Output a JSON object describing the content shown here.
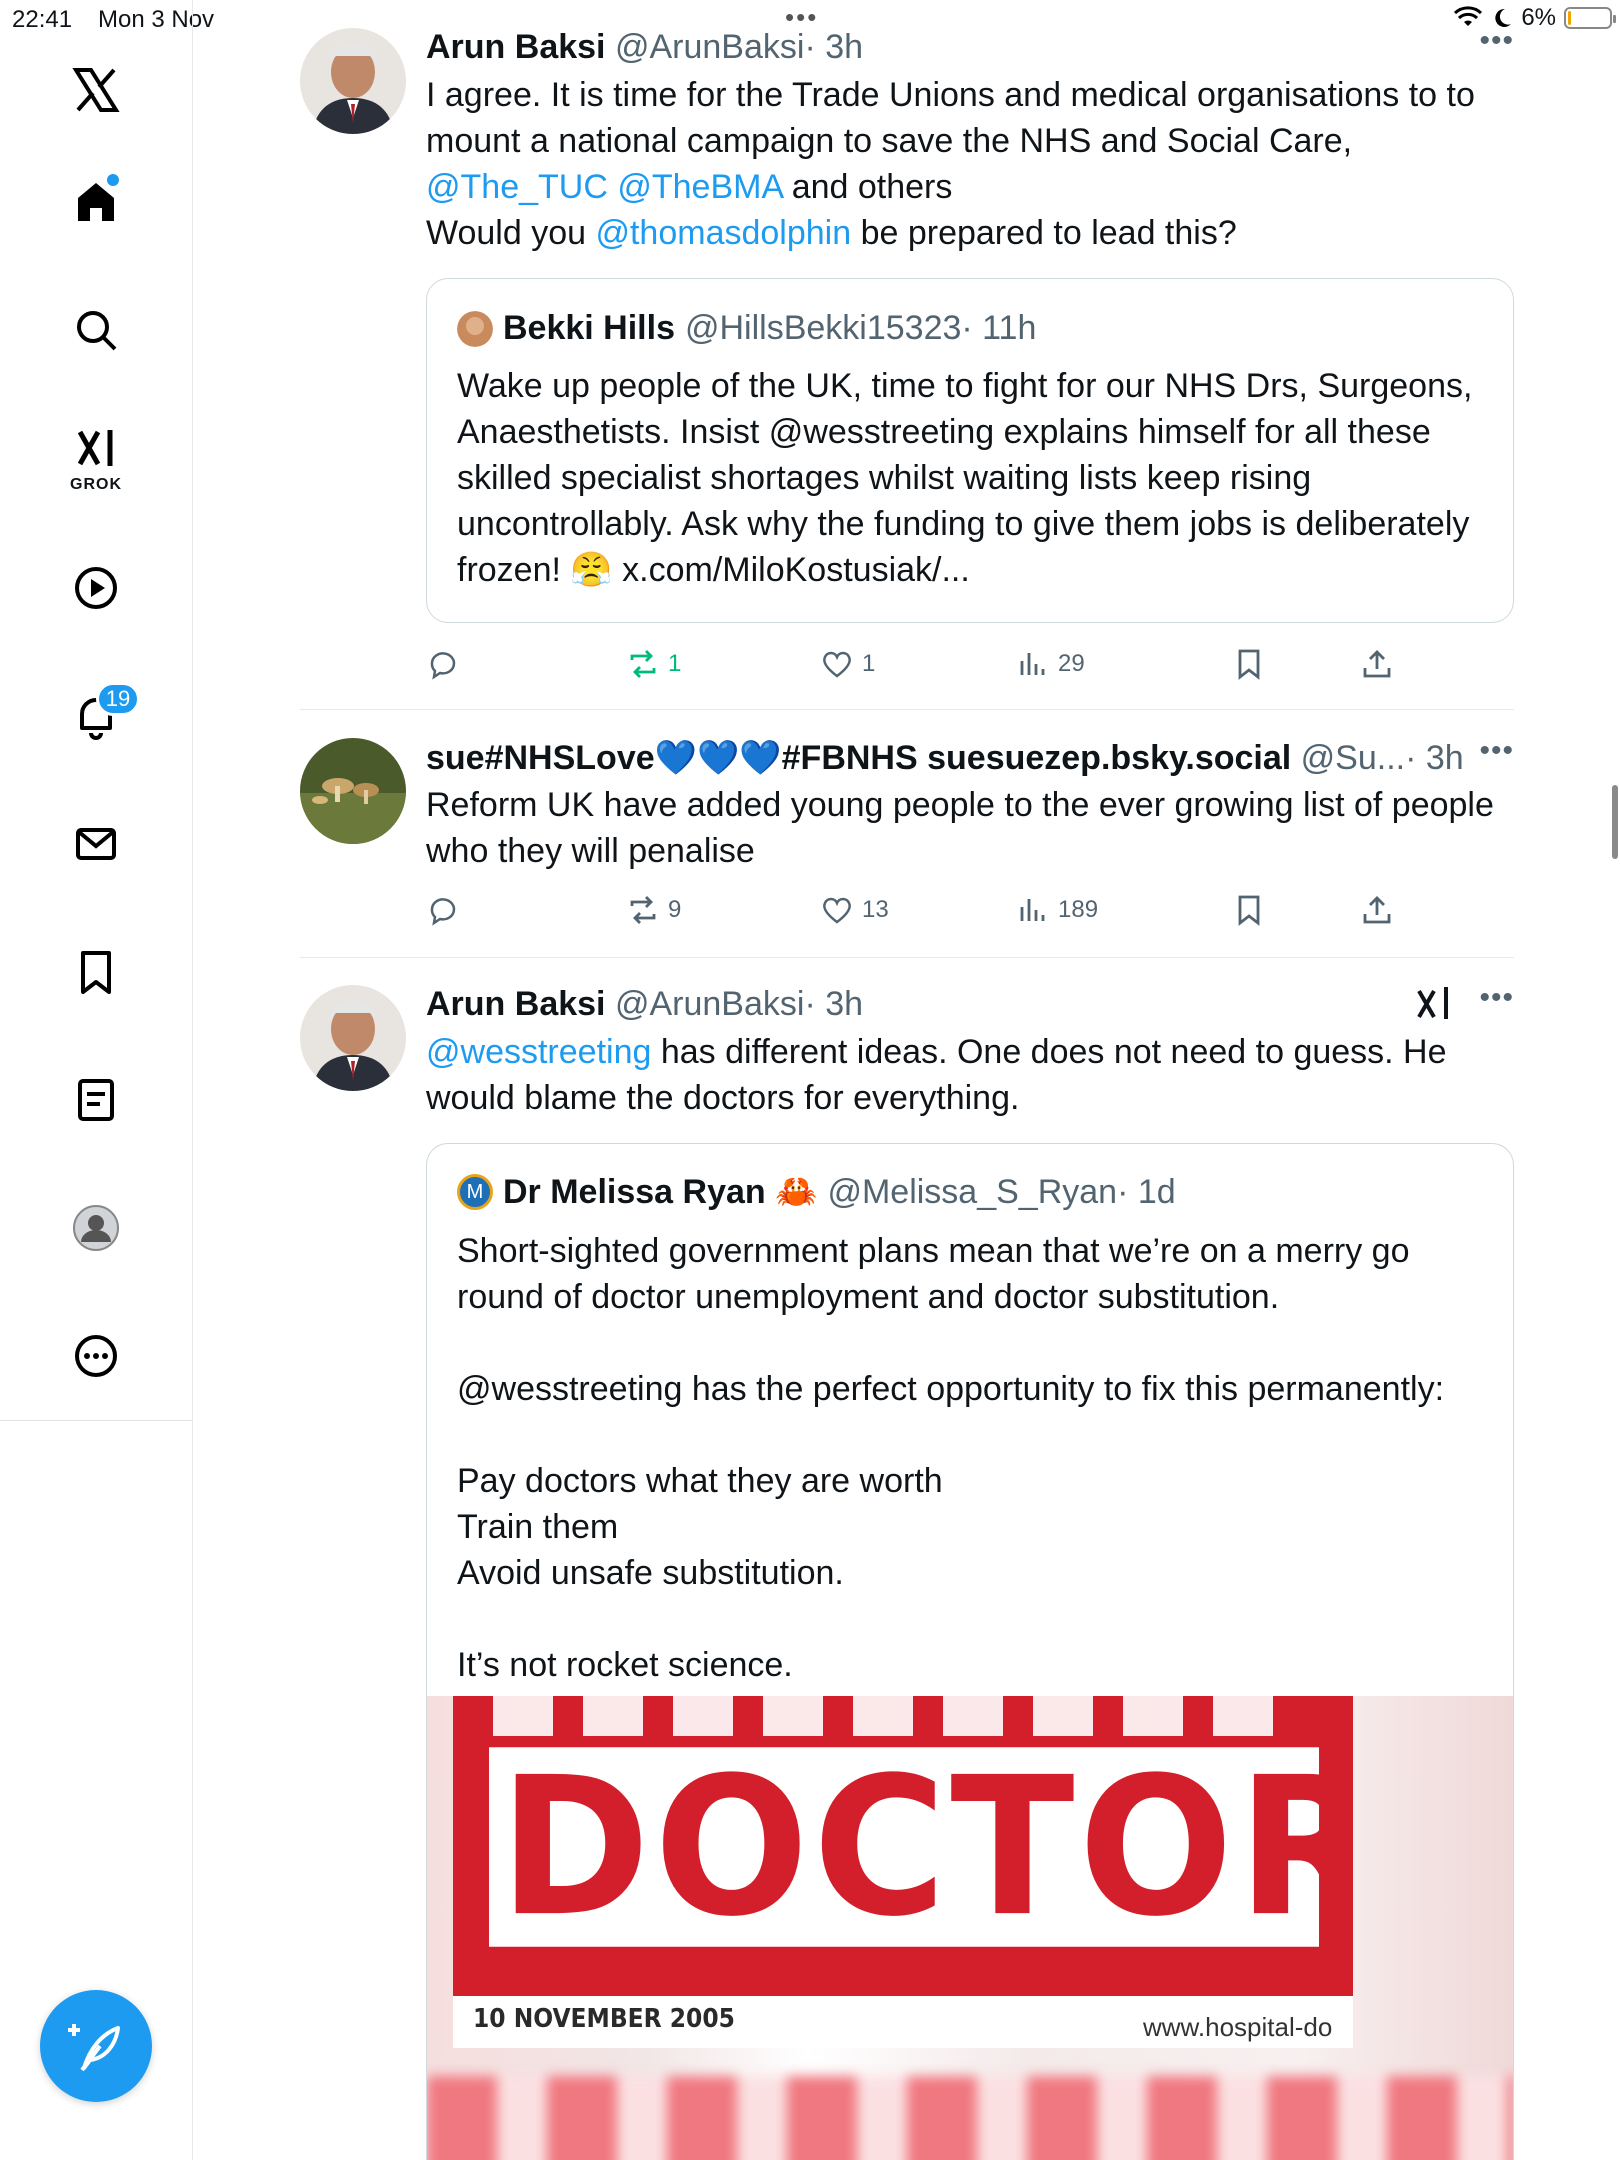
{
  "status_bar": {
    "time": "22:41",
    "date": "Mon 3 Nov",
    "battery_percent": "6%",
    "battery_level": 0.06
  },
  "sidebar": {
    "grok_label": "GROK",
    "notifications_badge": "19"
  },
  "feed": {
    "tweets": [
      {
        "name": "Arun Baksi",
        "handle": "@ArunBaksi",
        "time": "· 3h",
        "text_parts": [
          "I agree. It is time for the Trade Unions and medical organisations to to mount a national campaign to save the NHS and Social Care, ",
          "@The_TUC",
          " ",
          "@TheBMA",
          " and others",
          "Would you ",
          "@thomasdolphin",
          " be prepared to lead this?"
        ],
        "quote": {
          "name": "Bekki Hills",
          "handle": "@HillsBekki15323",
          "time": "· 11h",
          "text": "Wake up people of the UK, time to fight for our NHS Drs, Surgeons, Anaesthetists. Insist @wesstreeting explains himself for all these skilled specialist shortages whilst waiting lists keep rising uncontrollably. Ask why the funding to give them jobs is deliberately frozen! 😤 x.com/MiloKostusiak/..."
        },
        "actions": {
          "replies": "",
          "reposts": "1",
          "likes": "1",
          "views": "29"
        }
      },
      {
        "name": "sue#NHSLove💙💙💙#FBNHS suesuezep.bsky.social",
        "handle": "@Su...",
        "time": "· 3h",
        "text": "Reform UK have added young people to the ever growing list of people who they will penalise",
        "actions": {
          "replies": "",
          "reposts": "9",
          "likes": "13",
          "views": "189"
        }
      },
      {
        "name": "Arun Baksi",
        "handle": "@ArunBaksi",
        "time": "· 3h",
        "text_parts": [
          "@wesstreeting",
          " has different ideas. One does not need to guess. He would blame the doctors for everything."
        ],
        "quote": {
          "name": "Dr Melissa Ryan 🦀",
          "avatar_letter": "M",
          "handle": "@Melissa_S_Ryan",
          "time": "· 1d",
          "text": "Short-sighted government plans mean that we’re on a merry go round of doctor unemployment and doctor substitution.\n\n@wesstreeting has the perfect opportunity to fix this permanently:\n\nPay doctors what they are worth\nTrain them\nAvoid unsafe substitution.\n\nIt’s not rocket science.",
          "image": {
            "headline": "DOCTOR",
            "date": "10 NOVEMBER 2005",
            "url": "www.hospital-do"
          }
        }
      }
    ]
  },
  "colors": {
    "accent": "#1d9bf0",
    "repost_active": "#00ba7c",
    "muted_text": "#536471"
  }
}
